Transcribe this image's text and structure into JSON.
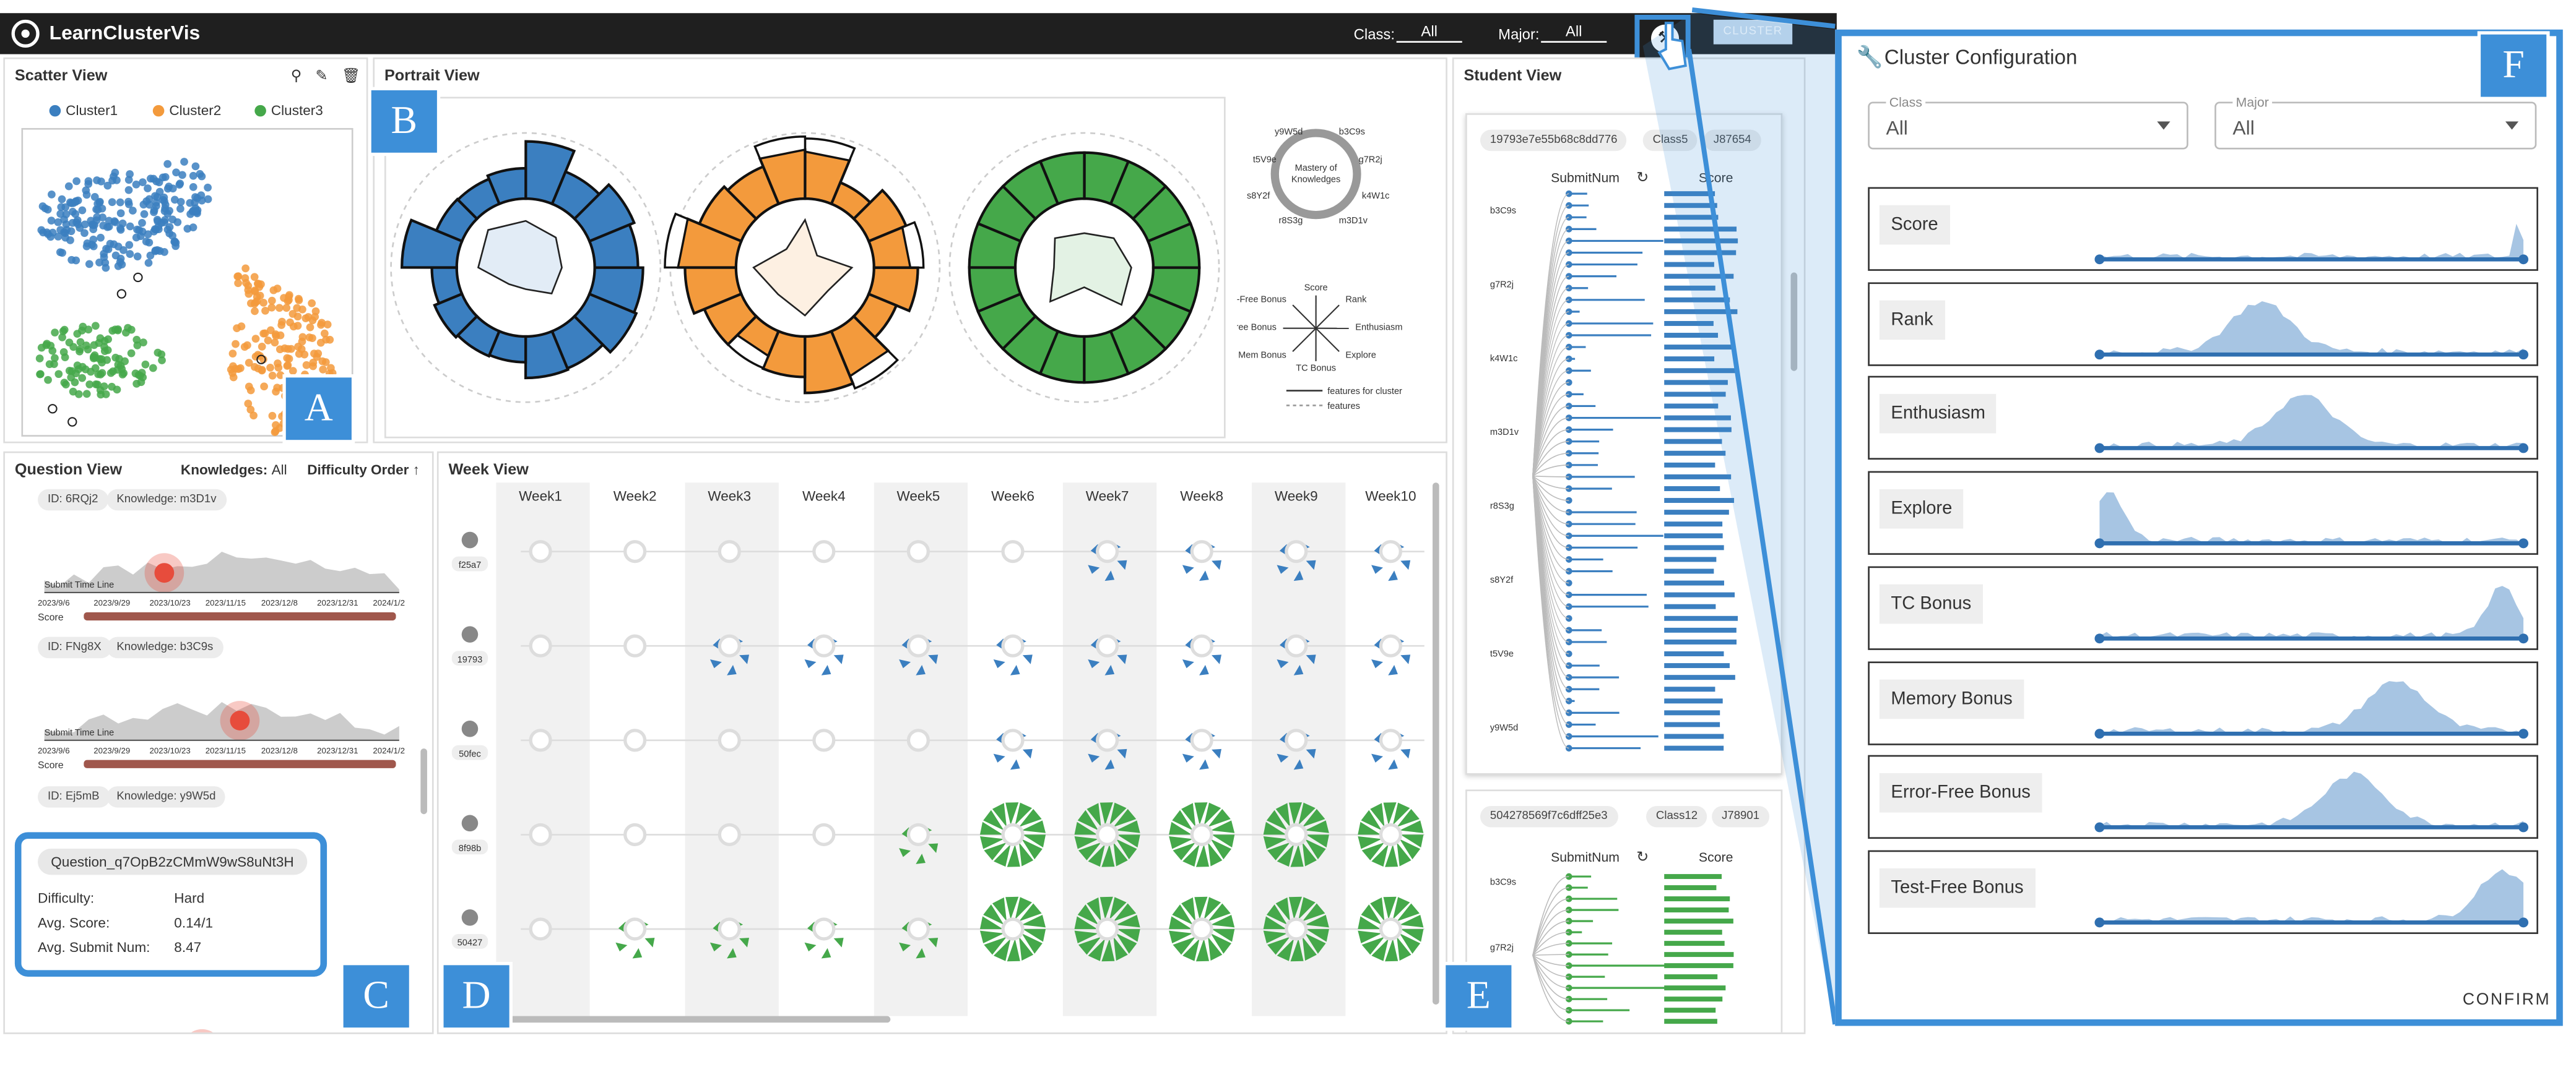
{
  "app": {
    "title": "LearnClusterVis",
    "class_label": "Class:",
    "class_value": "All",
    "major_label": "Major:",
    "major_value": "All",
    "cluster_button": "CLUSTER"
  },
  "scatter": {
    "title": "Scatter View",
    "legend": [
      "Cluster1",
      "Cluster2",
      "Cluster3"
    ],
    "badge": "A"
  },
  "portrait": {
    "title": "Portrait View",
    "badge": "B",
    "ring_legend": [
      "y9W5d",
      "b3C9s",
      "t5V9e",
      "g7R2j",
      "s8Y2f",
      "k4W1c",
      "r8S3g",
      "m3D1v"
    ],
    "ring_center": "Mastery of Knowledges",
    "radar_legend": [
      "Score",
      "Rank",
      "Enthusiasm",
      "Explore",
      "TC Bonus",
      "Mem Bonus",
      "Error-Free Bonus",
      "Test-Free Bonus"
    ],
    "line_legend": [
      "features for cluster",
      "features"
    ]
  },
  "question": {
    "title": "Question View",
    "knowledges_label": "Knowledges:",
    "knowledges_value": "All",
    "order_label": "Difficulty Order",
    "badge": "C",
    "items": [
      {
        "id": "ID: 6RQj2",
        "knowledge": "Knowledge: m3D1v",
        "timeline": "Submit Time Line",
        "score": "Score"
      },
      {
        "id": "ID: FNg8X",
        "knowledge": "Knowledge: b3C9s",
        "timeline": "Submit Time Line",
        "score": "Score"
      },
      {
        "id": "ID: Ej5mB",
        "knowledge": "Knowledge: y9W5d"
      }
    ],
    "dates": [
      "2023/9/6",
      "2023/9/29",
      "2023/10/23",
      "2023/11/15",
      "2023/12/8",
      "2023/12/31",
      "2024/1/2"
    ],
    "tooltip": {
      "id": "Question_q7OpB2zCMmW9wS8uNt3H",
      "difficulty_label": "Difficulty:",
      "difficulty": "Hard",
      "score_label": "Avg. Score:",
      "score": "0.14/1",
      "submit_label": "Avg. Submit Num:",
      "submit": "8.47"
    }
  },
  "week": {
    "title": "Week View",
    "badge": "D",
    "weeks": [
      "Week1",
      "Week2",
      "Week3",
      "Week4",
      "Week5",
      "Week6",
      "Week7",
      "Week8",
      "Week9",
      "Week10"
    ],
    "students": [
      "f25a7",
      "19793",
      "50fec",
      "8f98b",
      "50427"
    ]
  },
  "student": {
    "title": "Student View",
    "badge": "E",
    "cards": [
      {
        "id": "19793e7e55b68c8dd776",
        "class": "Class5",
        "major": "J87654",
        "col1": "SubmitNum",
        "col2": "Score",
        "labels": [
          "b3C9s",
          "g7R2j",
          "k4W1c",
          "m3D1v",
          "r8S3g",
          "s8Y2f",
          "t5V9e",
          "y9W5d"
        ]
      },
      {
        "id": "504278569f7c6dff25e3",
        "class": "Class12",
        "major": "J78901",
        "col1": "SubmitNum",
        "col2": "Score",
        "labels": [
          "b3C9s",
          "g7R2j"
        ]
      }
    ]
  },
  "config": {
    "title": "Cluster Configuration",
    "badge": "F",
    "class_label": "Class",
    "class_value": "All",
    "major_label": "Major",
    "major_value": "All",
    "features": [
      "Score",
      "Rank",
      "Enthusiasm",
      "Explore",
      "TC Bonus",
      "Memory Bonus",
      "Error-Free Bonus",
      "Test-Free Bonus"
    ],
    "confirm": "CONFIRM"
  },
  "colors": {
    "cluster1": "#3b7fc0",
    "cluster2": "#f39a3c",
    "cluster3": "#45a84a",
    "accent": "#3d8fd8"
  }
}
